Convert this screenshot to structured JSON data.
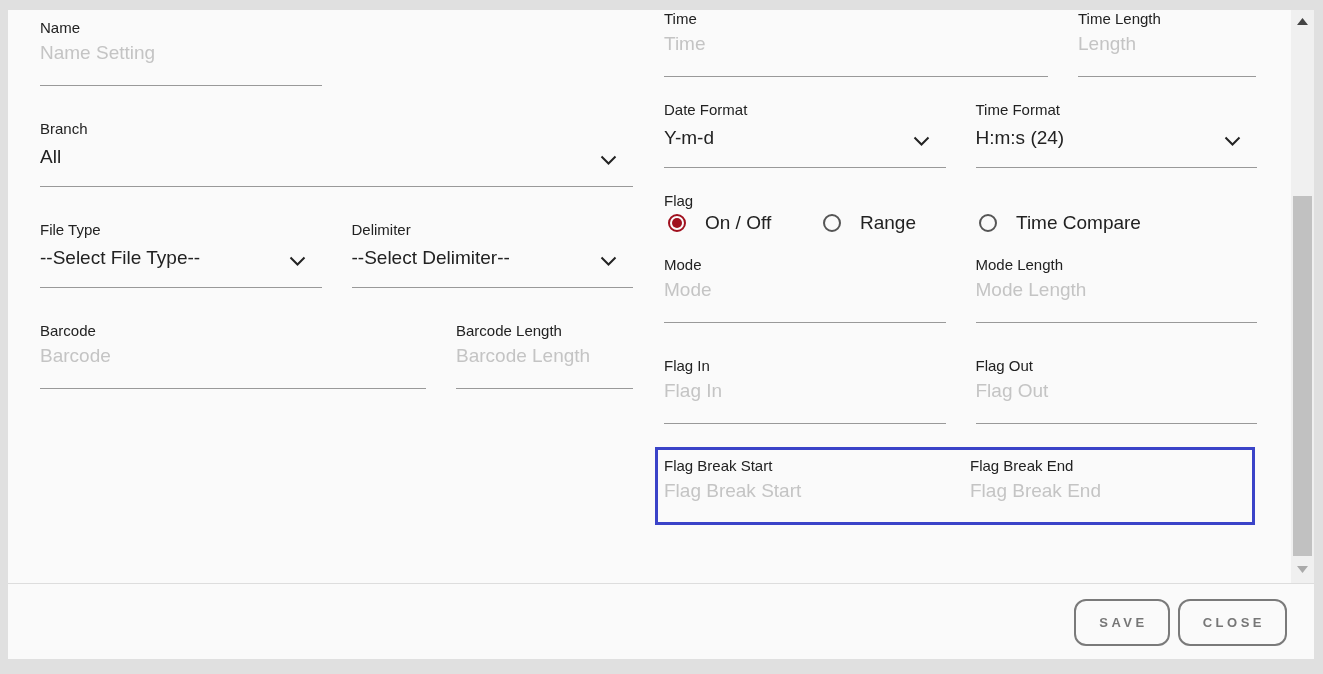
{
  "left": {
    "rows": [
      {
        "kind": "fields",
        "highlighted": false,
        "fields": [
          {
            "kind": "text",
            "label": "Name",
            "placeholder": "Name Setting"
          }
        ]
      },
      {
        "kind": "fields",
        "highlighted": false,
        "fields": [
          {
            "kind": "select",
            "label": "Branch",
            "value": "All"
          }
        ]
      },
      {
        "kind": "fields",
        "highlighted": false,
        "fields": [
          {
            "kind": "select",
            "label": "File Type",
            "value": "--Select File Type--"
          },
          {
            "kind": "select",
            "label": "Delimiter",
            "value": "--Select Delimiter--"
          }
        ]
      },
      {
        "kind": "fields",
        "highlighted": false,
        "fields": [
          {
            "kind": "text",
            "label": "Barcode",
            "placeholder": "Barcode"
          },
          {
            "kind": "text",
            "label": "Barcode Length",
            "placeholder": "Barcode Length"
          }
        ]
      }
    ]
  },
  "right": {
    "rows": [
      {
        "kind": "fields",
        "highlighted": false,
        "fields": [
          {
            "kind": "text",
            "label": "Time",
            "placeholder": "Time"
          },
          {
            "kind": "text",
            "label": "Time Length",
            "placeholder": "Length"
          }
        ]
      },
      {
        "kind": "fields",
        "highlighted": false,
        "fields": [
          {
            "kind": "select",
            "label": "Date Format",
            "value": "Y-m-d"
          },
          {
            "kind": "select",
            "label": "Time Format",
            "value": "H:m:s (24)"
          }
        ]
      },
      {
        "kind": "radio",
        "highlighted": false,
        "label": "Flag",
        "options": [
          {
            "label": "On / Off",
            "selected": true
          },
          {
            "label": "Range",
            "selected": false
          },
          {
            "label": "Time Compare",
            "selected": false
          }
        ]
      },
      {
        "kind": "fields",
        "highlighted": false,
        "fields": [
          {
            "kind": "text",
            "label": "Mode",
            "placeholder": "Mode"
          },
          {
            "kind": "text",
            "label": "Mode Length",
            "placeholder": "Mode Length"
          }
        ]
      },
      {
        "kind": "fields",
        "highlighted": false,
        "fields": [
          {
            "kind": "text",
            "label": "Flag In",
            "placeholder": "Flag In"
          },
          {
            "kind": "text",
            "label": "Flag Out",
            "placeholder": "Flag Out"
          }
        ]
      },
      {
        "kind": "fields",
        "highlighted": true,
        "fields": [
          {
            "kind": "text",
            "label": "Flag Break Start",
            "placeholder": "Flag Break Start"
          },
          {
            "kind": "text",
            "label": "Flag Break End",
            "placeholder": "Flag Break End"
          }
        ]
      }
    ]
  },
  "footer": {
    "buttons": [
      "SAVE",
      "CLOSE"
    ]
  }
}
